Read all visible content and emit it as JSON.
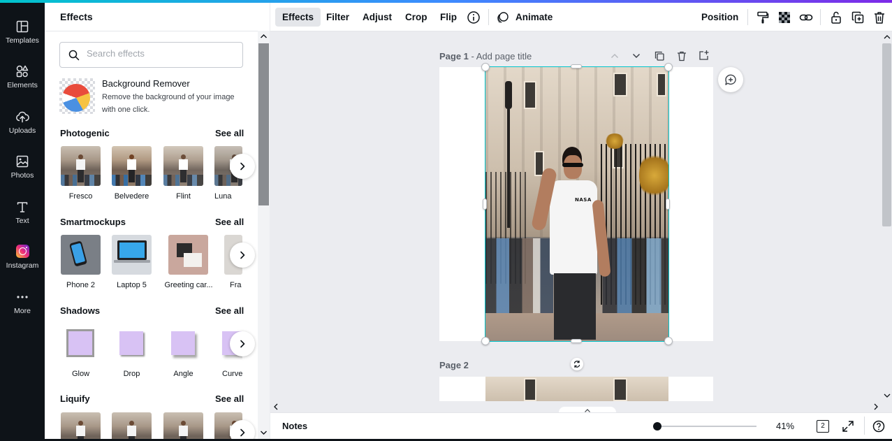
{
  "rail": {
    "items": [
      {
        "label": "Templates",
        "icon": "templates-icon"
      },
      {
        "label": "Elements",
        "icon": "elements-icon"
      },
      {
        "label": "Uploads",
        "icon": "upload-cloud-icon"
      },
      {
        "label": "Photos",
        "icon": "photos-icon"
      },
      {
        "label": "Text",
        "icon": "text-icon"
      },
      {
        "label": "Instagram",
        "icon": "instagram-icon"
      },
      {
        "label": "More",
        "icon": "more-dots-icon"
      }
    ]
  },
  "panel": {
    "title": "Effects",
    "search_placeholder": "Search effects",
    "bg_remover": {
      "title": "Background Remover",
      "description": "Remove the background of your image with one click."
    },
    "see_all": "See all",
    "sections": [
      {
        "title": "Photogenic",
        "items": [
          "Fresco",
          "Belvedere",
          "Flint",
          "Luna"
        ]
      },
      {
        "title": "Smartmockups",
        "items": [
          "Phone 2",
          "Laptop 5",
          "Greeting car...",
          "Fra"
        ]
      },
      {
        "title": "Shadows",
        "items": [
          "Glow",
          "Drop",
          "Angle",
          "Curve"
        ]
      },
      {
        "title": "Liquify",
        "items": []
      }
    ]
  },
  "toolbar": {
    "effects": "Effects",
    "filter": "Filter",
    "adjust": "Adjust",
    "crop": "Crop",
    "flip": "Flip",
    "animate": "Animate",
    "position": "Position"
  },
  "canvas": {
    "page1_label": "Page 1",
    "page1_title_placeholder": " - Add page title",
    "page2_label": "Page 2",
    "photo_text": "NASA"
  },
  "bottom": {
    "notes": "Notes",
    "zoom": "41%",
    "page_count": "2"
  },
  "colors": {
    "accent": "#00c4cc",
    "rail_bg": "#0e1318",
    "canvas_bg": "#ebecf0",
    "shadow_swatch": "#d8c2f4"
  }
}
